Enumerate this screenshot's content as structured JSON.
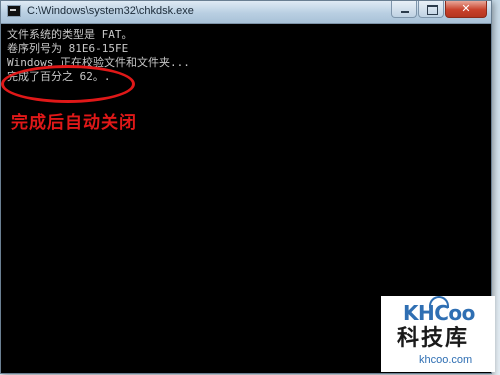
{
  "window": {
    "title": "C:\\Windows\\system32\\chkdsk.exe",
    "close_glyph": "✕"
  },
  "console": {
    "lines": [
      "文件系统的类型是 FAT。",
      "卷序列号为 81E6-15FE",
      "Windows 正在校验文件和文件夹...",
      "完成了百分之 62。."
    ]
  },
  "annotation": {
    "text": "完成后自动关闭",
    "color": "#e01818"
  },
  "watermark": {
    "logo": "KHCoo",
    "name": "科技库",
    "domain": "khcoo.com",
    "color": "#2f6fb3"
  }
}
